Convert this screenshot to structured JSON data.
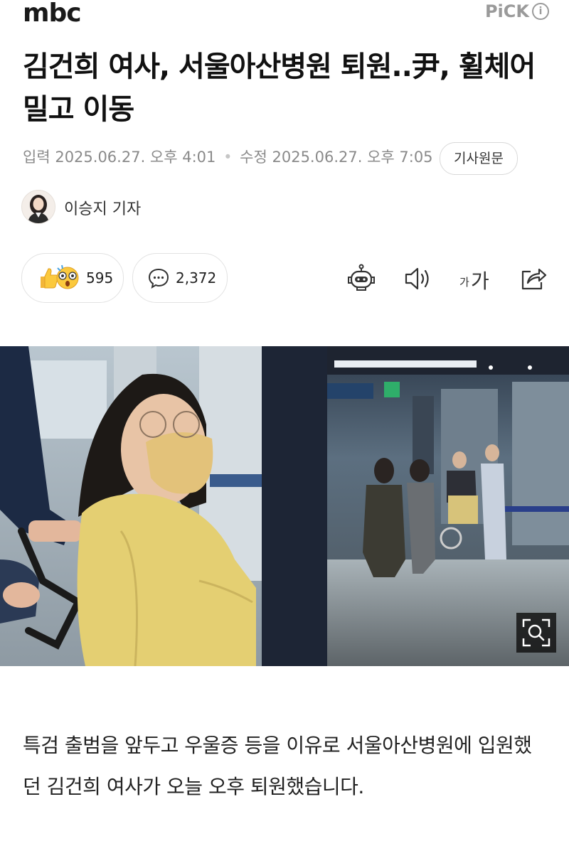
{
  "header": {
    "logo": "mbc",
    "pick_label": "PiCK",
    "info_label": "i"
  },
  "article": {
    "title": "김건희 여사, 서울아산병원 퇴원..尹, 휠체어 밀고 이동",
    "input_label": "입력",
    "input_time": "2025.06.27. 오후 4:01",
    "edit_label": "수정",
    "edit_time": "2025.06.27. 오후 7:05",
    "original_button": "기사원문",
    "reporter": "이승지 기자",
    "body": "특검 출범을 앞두고 우울증 등을 이유로 서울아산병원에 입원했던 김건희 여사가 오늘 오후 퇴원했습니다."
  },
  "actions": {
    "reaction_count": "595",
    "comment_count": "2,372",
    "font_size_small": "가",
    "font_size_large": "가"
  },
  "icons": [
    "thumbs-up-icon",
    "surprised-face-icon",
    "comment-icon",
    "robot-summary-icon",
    "speaker-icon",
    "font-size-icon",
    "share-icon",
    "zoom-icon"
  ],
  "colors": {
    "background": "#ffffff",
    "title": "#111111",
    "meta": "#8a8a8a",
    "pick": "#9a9a9a"
  }
}
